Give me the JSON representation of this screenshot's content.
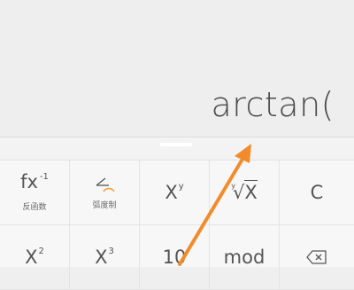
{
  "display": {
    "expression": "arctan("
  },
  "keypad": {
    "row1": {
      "fx": {
        "main": "fx",
        "sup": "-1",
        "sub": "反函数"
      },
      "rad": {
        "sub": "弧度制"
      },
      "xy": {
        "main": "X",
        "sup": "y"
      },
      "root": {
        "main": "X",
        "sup": "y"
      },
      "clear": {
        "main": "C"
      }
    },
    "row2": {
      "square": {
        "main": "X",
        "sup": "2"
      },
      "cube": {
        "main": "X",
        "sup": "3"
      },
      "ten": {
        "main": "10"
      },
      "mod": {
        "main": "mod"
      }
    }
  },
  "colors": {
    "display_bg": "#eeeeee",
    "keypad_bg": "#f7f7f7",
    "accent_arc": "#f2a23a",
    "annotation_arrow": "#f28c2b"
  },
  "icons": {
    "rad_key": "angle-icon",
    "delete_key": "backspace-icon"
  }
}
